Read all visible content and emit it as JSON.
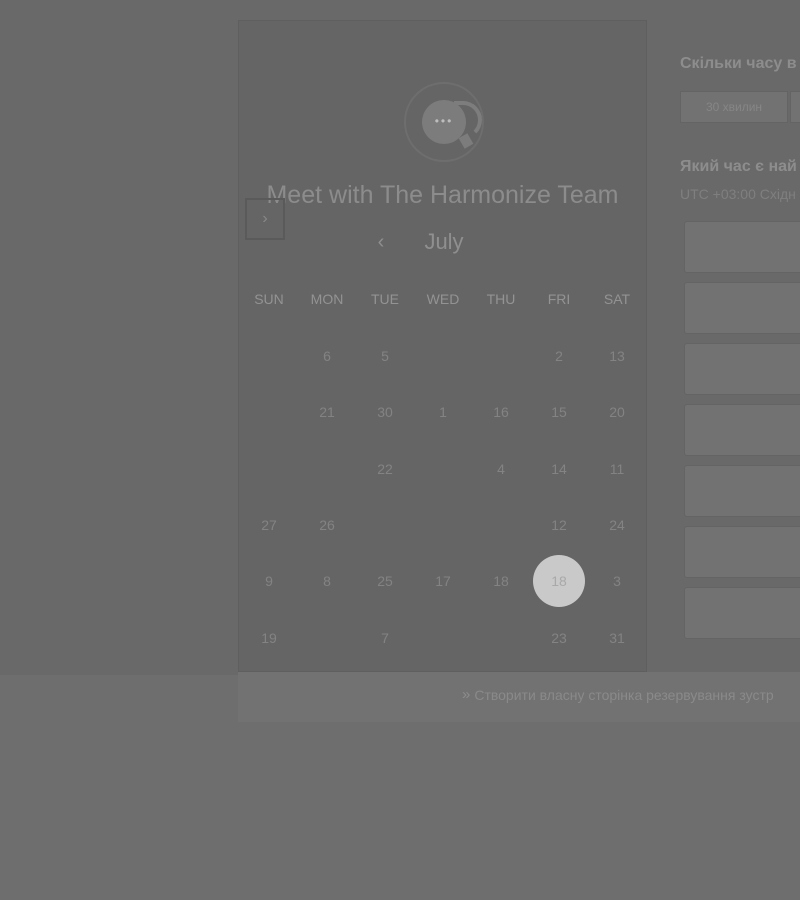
{
  "panel": {
    "title": "Meet with The Harmonize Team",
    "avatar_icon": "chat-bubble-icon",
    "avatar_dots": "•••",
    "month": "July",
    "prev_icon": "‹",
    "next_icon": "›",
    "days_of_week": [
      "SUN",
      "MON",
      "TUE",
      "WED",
      "THU",
      "FRI",
      "SAT"
    ],
    "cells": [
      {
        "label": "6",
        "col": 1,
        "row": 0
      },
      {
        "label": "5",
        "col": 2,
        "row": 0
      },
      {
        "label": "2",
        "col": 5,
        "row": 0
      },
      {
        "label": "13",
        "col": 6,
        "row": 0
      },
      {
        "label": "21",
        "col": 1,
        "row": 1
      },
      {
        "label": "30",
        "col": 2,
        "row": 1
      },
      {
        "label": "1",
        "col": 3,
        "row": 1
      },
      {
        "label": "16",
        "col": 4,
        "row": 1
      },
      {
        "label": "15",
        "col": 5,
        "row": 1
      },
      {
        "label": "20",
        "col": 6,
        "row": 1
      },
      {
        "label": "22",
        "col": 2,
        "row": 2
      },
      {
        "label": "4",
        "col": 4,
        "row": 2
      },
      {
        "label": "14",
        "col": 5,
        "row": 2
      },
      {
        "label": "11",
        "col": 6,
        "row": 2
      },
      {
        "label": "27",
        "col": 0,
        "row": 3
      },
      {
        "label": "26",
        "col": 1,
        "row": 3
      },
      {
        "label": "12",
        "col": 5,
        "row": 3
      },
      {
        "label": "24",
        "col": 6,
        "row": 3
      },
      {
        "label": "9",
        "col": 0,
        "row": 4
      },
      {
        "label": "8",
        "col": 1,
        "row": 4
      },
      {
        "label": "25",
        "col": 2,
        "row": 4
      },
      {
        "label": "17",
        "col": 3,
        "row": 4
      },
      {
        "label": "18",
        "col": 4,
        "row": 4
      },
      {
        "label": "18",
        "col": 5,
        "row": 4,
        "selected": true
      },
      {
        "label": "3",
        "col": 6,
        "row": 4
      },
      {
        "label": "19",
        "col": 0,
        "row": 5
      },
      {
        "label": "7",
        "col": 2,
        "row": 5
      },
      {
        "label": "23",
        "col": 5,
        "row": 5
      },
      {
        "label": "31",
        "col": 6,
        "row": 5
      }
    ]
  },
  "right": {
    "duration_question": "Скільки часу в",
    "duration_option": "30 хвилин",
    "time_question": "Який час є най",
    "timezone": "UTC +03:00 Східн",
    "slot_count": 7
  },
  "footer": {
    "icon": "arrow-icon",
    "link_text": "Створити власну сторінка резервування зустр"
  },
  "colors": {
    "overlay": "#6b6b6b",
    "panel": "#656565",
    "selected_day": "#c9c9c9"
  }
}
